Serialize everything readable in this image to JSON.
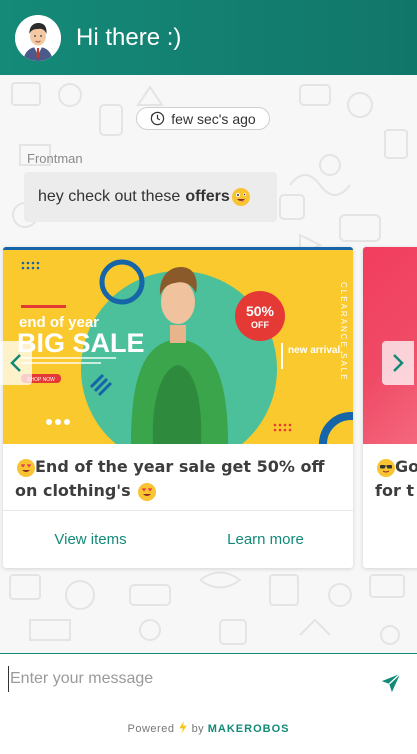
{
  "header": {
    "title": "Hi there :)",
    "avatar_icon": "user-avatar"
  },
  "chat": {
    "timestamp": "few sec's ago",
    "sender": "Frontman",
    "message_text": "hey check out these",
    "message_bold": "offers"
  },
  "cards": [
    {
      "banner": {
        "headline_small": "end of year",
        "headline_big": "BIG SALE",
        "badge_percent": "50%",
        "badge_off": "OFF",
        "side_text": "new arrival.",
        "vertical_text": "CLEARANCE SALE",
        "shop_now": "SHOP NOW"
      },
      "title": "End of the year sale get 50% off on clothing's",
      "actions": [
        "View items",
        "Learn more"
      ]
    },
    {
      "title_fragment_1": "Go",
      "title_fragment_2": "for t"
    }
  ],
  "composer": {
    "placeholder": "Enter your message",
    "powered_by": "Powered",
    "by": "by",
    "brand": "MAKEROBOS"
  },
  "colors": {
    "primary": "#138a78",
    "banner_yellow": "#f9c92e",
    "badge_red": "#e53935"
  }
}
